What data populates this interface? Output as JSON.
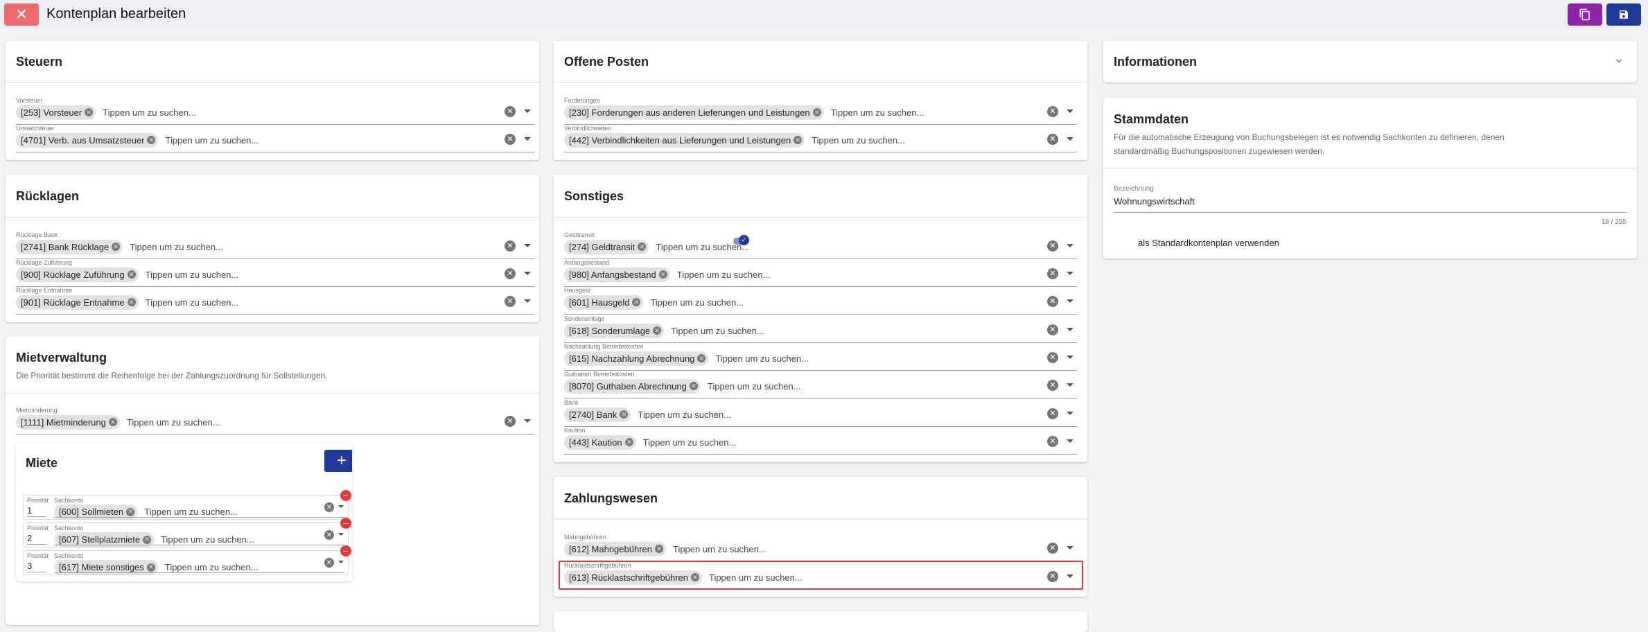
{
  "header": {
    "title": "Kontenplan bearbeiten"
  },
  "steuern": {
    "title": "Steuern",
    "fields": [
      {
        "label": "Vorsteuer",
        "chip": "[253] Vorsteuer",
        "placeholder": "Tippen um zu suchen..."
      },
      {
        "label": "Umsatzsteuer",
        "chip": "[4701] Verb. aus Umsatzsteuer",
        "placeholder": "Tippen um zu suchen..."
      }
    ]
  },
  "ruecklagen": {
    "title": "Rücklagen",
    "fields": [
      {
        "label": "Rücklage Bank",
        "chip": "[2741] Bank Rücklage",
        "placeholder": "Tippen um zu suchen..."
      },
      {
        "label": "Rücklage Zuführung",
        "chip": "[900] Rücklage Zuführung",
        "placeholder": "Tippen um zu suchen..."
      },
      {
        "label": "Rücklage Entnahme",
        "chip": "[901] Rücklage Entnahme",
        "placeholder": "Tippen um zu suchen..."
      }
    ]
  },
  "mietverwaltung": {
    "title": "Mietverwaltung",
    "subtitle": "Die Priorität bestimmt die Reihenfolge bei der Zahlungszuordnung für Sollstellungen.",
    "field": {
      "label": "Mietminderung",
      "chip": "[1111] Mietminderung",
      "placeholder": "Tippen um zu suchen..."
    },
    "miete": {
      "title": "Miete",
      "rows": [
        {
          "prio_label": "Priorität",
          "prio": "1",
          "sk_label": "Sachkonto",
          "chip": "[600] Sollmieten",
          "placeholder": "Tippen um zu suchen..."
        },
        {
          "prio_label": "Priorität",
          "prio": "2",
          "sk_label": "Sachkonto",
          "chip": "[607] Stellplatzmiete",
          "placeholder": "Tippen um zu suchen..."
        },
        {
          "prio_label": "Priorität",
          "prio": "3",
          "sk_label": "Sachkonto",
          "chip": "[617] Miete sonstiges",
          "placeholder": "Tippen um zu suchen..."
        }
      ]
    }
  },
  "offene_posten": {
    "title": "Offene Posten",
    "fields": [
      {
        "label": "Forderungen",
        "chip": "[230] Forderungen aus anderen Lieferungen und Leistungen",
        "placeholder": "Tippen um zu suchen..."
      },
      {
        "label": "Verbindlichkeiten",
        "chip": "[442] Verbindlichkeiten aus Lieferungen und Leistungen",
        "placeholder": "Tippen um zu suchen..."
      }
    ]
  },
  "sonstiges": {
    "title": "Sonstiges",
    "fields": [
      {
        "label": "Geldtransit",
        "chip": "[274] Geldtransit",
        "placeholder": "Tippen um zu suchen..."
      },
      {
        "label": "Anfangsbestand",
        "chip": "[980] Anfangsbestand",
        "placeholder": "Tippen um zu suchen..."
      },
      {
        "label": "Hausgeld",
        "chip": "[601] Hausgeld",
        "placeholder": "Tippen um zu suchen..."
      },
      {
        "label": "Sonderumlage",
        "chip": "[618] Sonderumlage",
        "placeholder": "Tippen um zu suchen..."
      },
      {
        "label": "Nachzahlung Betriebskosten",
        "chip": "[615] Nachzahlung Abrechnung",
        "placeholder": "Tippen um zu suchen..."
      },
      {
        "label": "Guthaben Betriebskosten",
        "chip": "[8070] Guthaben Abrechnung",
        "placeholder": "Tippen um zu suchen..."
      },
      {
        "label": "Bank",
        "chip": "[2740] Bank",
        "placeholder": "Tippen um zu suchen..."
      },
      {
        "label": "Kaution",
        "chip": "[443] Kaution",
        "placeholder": "Tippen um zu suchen..."
      }
    ]
  },
  "zahlungswesen": {
    "title": "Zahlungswesen",
    "fields": [
      {
        "label": "Mahngebühren",
        "chip": "[612] Mahngebühren",
        "placeholder": "Tippen um zu suchen..."
      },
      {
        "label": "Rücklastschriftgebühren",
        "chip": "[613] Rücklastschriftgebühren",
        "placeholder": "Tippen um zu suchen..."
      }
    ]
  },
  "informationen": {
    "title": "Informationen"
  },
  "stammdaten": {
    "title": "Stammdaten",
    "description": "Für die automatische Erzeugung von Buchungsbelegen ist es notwendig Sachkonten zu definieren, denen standardmäßig Buchungspositionen zugewiesen werden.",
    "bezeichnung_label": "Bezeichnung",
    "bezeichnung_value": "Wohnungswirtschaft",
    "counter": "18 / 255",
    "toggle_label": "als Standardkontenplan verwenden",
    "toggle_on": true
  },
  "colors": {
    "close_button": "#ef6b6b",
    "copy_button": "#8e24aa",
    "save_button": "#1e3a9a",
    "add_button": "#1e3a9a",
    "remove_button": "#e53935",
    "highlight": "#e53935"
  }
}
